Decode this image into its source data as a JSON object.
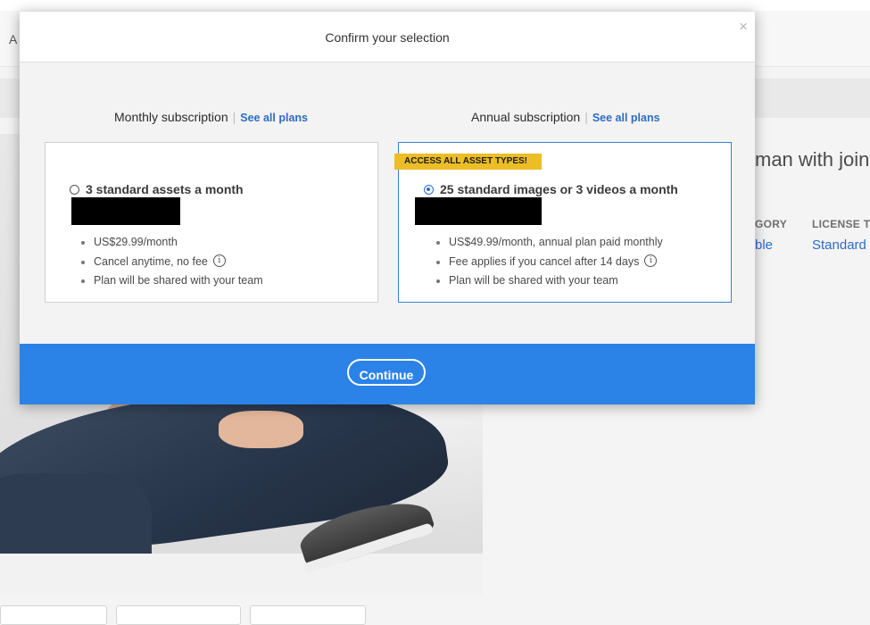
{
  "background": {
    "header_letter": "A",
    "title_fragment": "man with joint",
    "meta": [
      {
        "head": "GORY",
        "value": "ble"
      },
      {
        "head": "LICENSE TY",
        "value": "Standard"
      }
    ]
  },
  "dialog": {
    "title": "Confirm your selection",
    "close_label": "×",
    "monthly": {
      "heading": "Monthly subscription",
      "link": "See all plans",
      "option": "3 standard assets a month",
      "selected": false,
      "features": [
        "US$29.99/month",
        "Cancel anytime, no fee",
        "Plan will be shared with your team"
      ]
    },
    "annual": {
      "heading": "Annual subscription",
      "link": "See all plans",
      "badge": "ACCESS ALL ASSET TYPES!",
      "option": "25 standard images or 3 videos a month",
      "selected": true,
      "features": [
        "US$49.99/month, annual plan paid monthly",
        "Fee applies if you cancel after 14 days",
        "Plan will be shared with your team"
      ]
    },
    "info_icon": "i",
    "continue_label": "Continue"
  }
}
